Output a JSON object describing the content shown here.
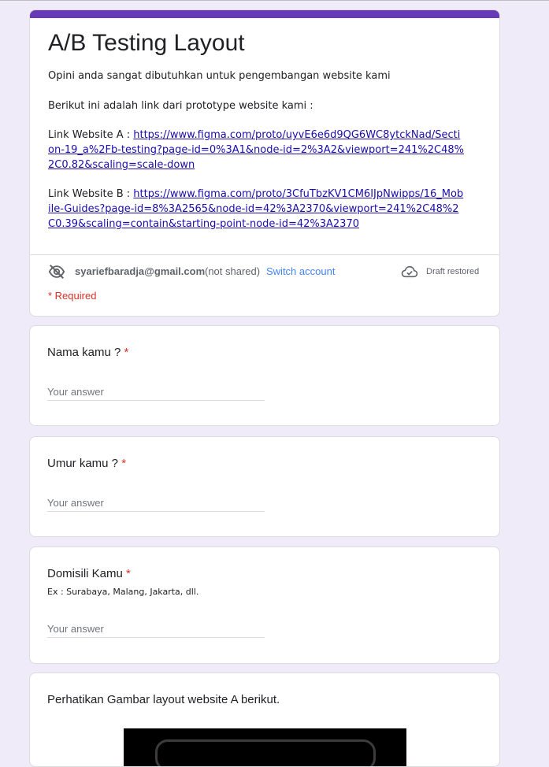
{
  "form": {
    "title": "A/B Testing Layout",
    "description_line1": "Opini anda sangat dibutuhkan untuk pengembangan website kami",
    "description_line2": "Berikut ini adalah link dari prototype website kami :",
    "link_a_label": "Link Website A : ",
    "link_a_url": "https://www.figma.com/proto/uyvE6e6d9QG6WC8ytckNad/Section-19_a%2Fb-testing?page-id=0%3A1&node-id=2%3A2&viewport=241%2C48%2C0.82&scaling=scale-down",
    "link_b_label": "Link Website B : ",
    "link_b_url": "https://www.figma.com/proto/3CfuTbzKV1CM6IJpNwipps/16_Mobile-Guides?page-id=8%3A2565&node-id=42%3A2370&viewport=241%2C48%2C0.39&scaling=contain&starting-point-node-id=42%3A2370"
  },
  "account": {
    "email": "syariefbaradja@gmail.com",
    "not_shared": "(not shared)",
    "switch_label": "Switch account",
    "draft_status": "Draft restored"
  },
  "required_note": "* Required",
  "questions": [
    {
      "title": "Nama kamu ? ",
      "required_mark": "*",
      "help": "",
      "placeholder": "Your answer"
    },
    {
      "title": "Umur kamu ? ",
      "required_mark": "*",
      "help": "",
      "placeholder": "Your answer"
    },
    {
      "title": "Domisili Kamu ",
      "required_mark": "*",
      "help": "Ex : Surabaya, Malang, Jakarta, dll.",
      "placeholder": "Your answer"
    }
  ],
  "image_section": {
    "title": "Perhatikan Gambar layout website A berikut."
  },
  "colors": {
    "accent": "#673ab7",
    "background": "#f0ebf8",
    "required": "#d93025",
    "link": "#1a0dab",
    "switch_link": "#4285f4"
  },
  "icons": {
    "visibility": "eye-off-icon",
    "cloud": "cloud-check-icon"
  }
}
